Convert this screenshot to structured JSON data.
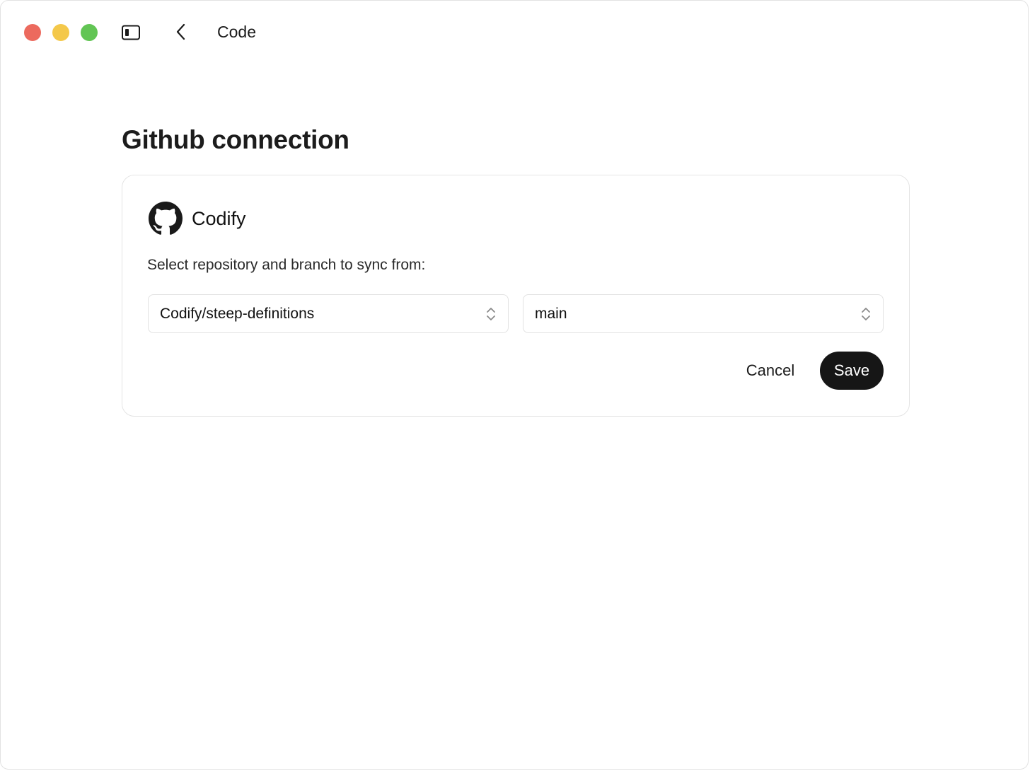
{
  "window": {
    "title": "Code",
    "traffic_lights": {
      "close_color": "#ec6a5e",
      "minimize_color": "#f4c84a",
      "zoom_color": "#62c554"
    },
    "icons": {
      "sidebar_toggle": "sidebar-toggle-icon",
      "back": "chevron-left-icon"
    }
  },
  "page": {
    "title": "Github connection"
  },
  "card": {
    "provider_icon": "github-icon",
    "provider_name": "Codify",
    "instructions": "Select repository and branch to sync from:",
    "repository_select": {
      "value": "Codify/steep-definitions",
      "icon": "chevron-up-down-icon"
    },
    "branch_select": {
      "value": "main",
      "icon": "chevron-up-down-icon"
    },
    "cancel_label": "Cancel",
    "save_label": "Save"
  },
  "colors": {
    "primary_button": "#161616",
    "border": "#e2e2e2"
  }
}
